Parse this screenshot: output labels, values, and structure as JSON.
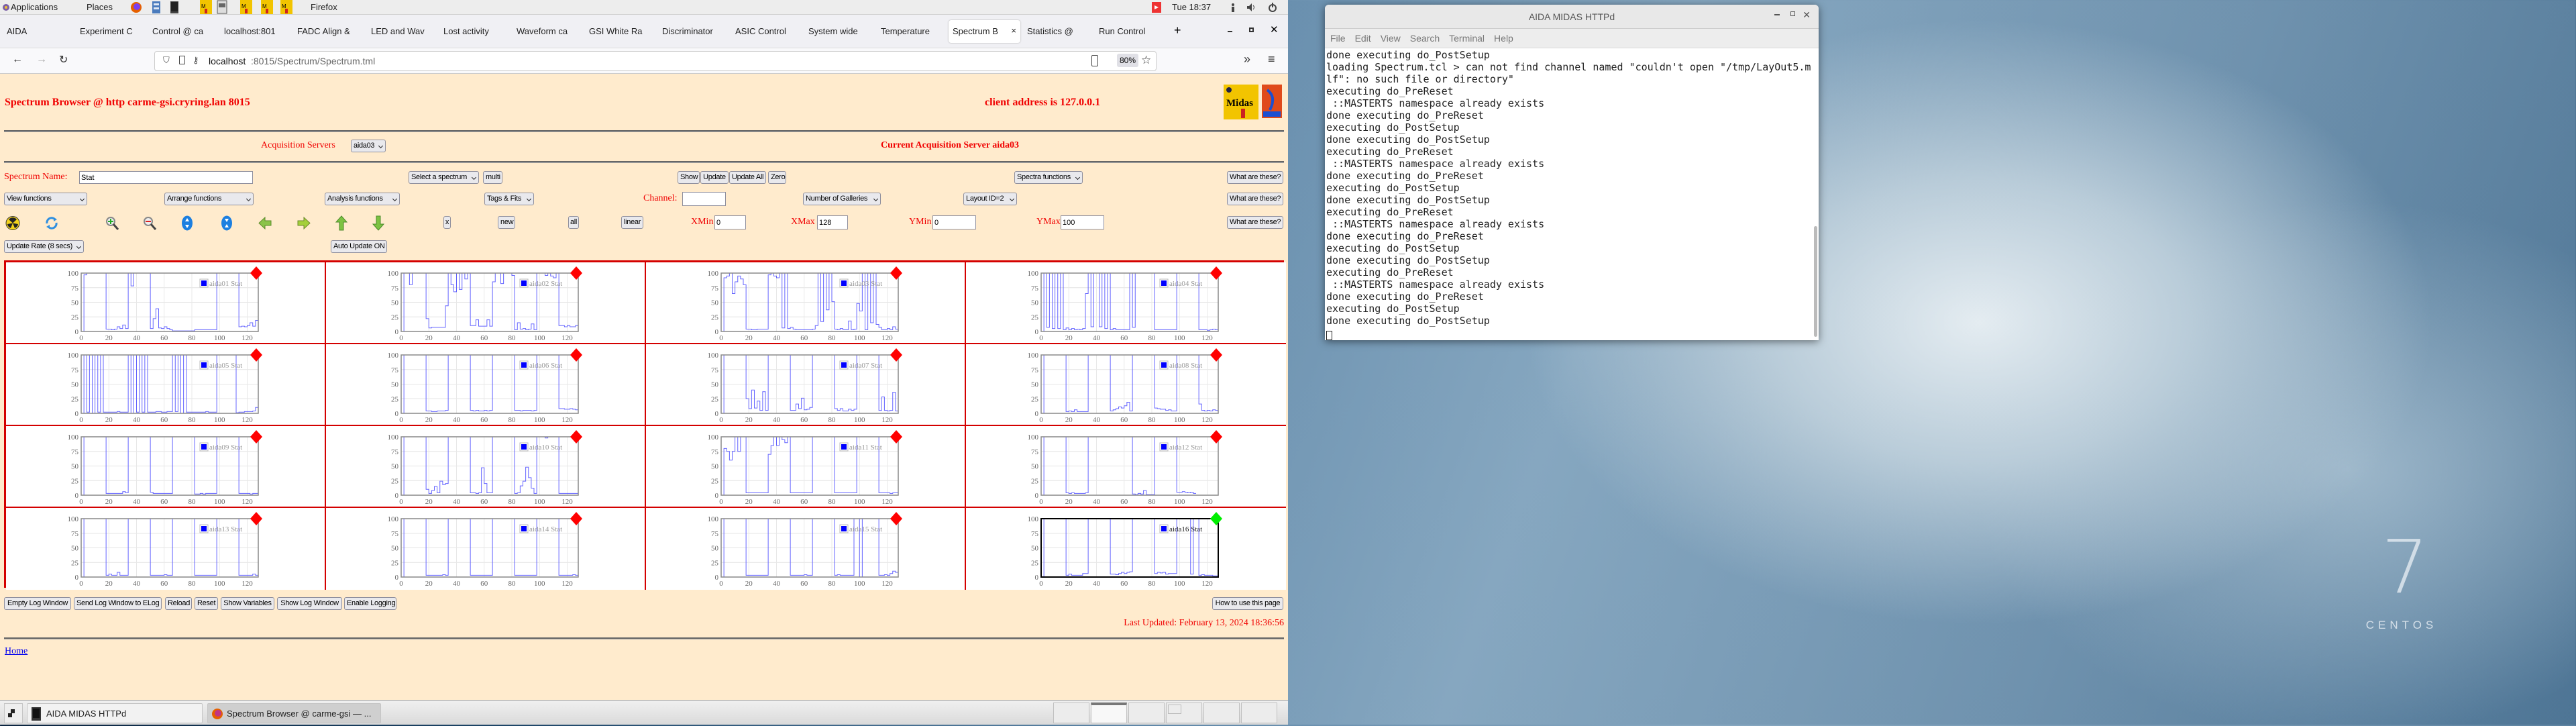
{
  "top_panel": {
    "applications": "Applications",
    "places": "Places",
    "app_name": "Firefox",
    "clock": "Tue 18:37"
  },
  "browser": {
    "tabs": [
      "AIDA",
      "Experiment C",
      "Control @ ca",
      "localhost:801",
      "FADC Align &",
      "LED and Wav",
      "Lost activity",
      "Waveform ca",
      "GSI White Ra",
      "Discriminator",
      "ASIC Control",
      "System wide",
      "Temperature",
      "Spectrum B",
      "Statistics @",
      "Run Control"
    ],
    "active_tab": 13,
    "new_tab": "+",
    "url_host": "localhost",
    "url_path": ":8015/Spectrum/Spectrum.tml",
    "zoom": "80%"
  },
  "page": {
    "title": "Spectrum Browser @ http carme-gsi.cryring.lan 8015",
    "client_address": "client address is 127.0.0.1",
    "acq_label": "Acquisition Servers",
    "acq_select": "aida03",
    "current_server": "Current Acquisition Server aida03",
    "spectrum_name_label": "Spectrum Name:",
    "spectrum_name_value": "Stat",
    "select_spectrum": "Select a spectrum",
    "multi": "multi",
    "show": "Show",
    "update": "Update",
    "update_all": "Update All",
    "zero": "Zero",
    "spectra_functions": "Spectra functions",
    "what_are_these": "What are these?",
    "view_functions": "View functions",
    "arrange_functions": "Arrange functions",
    "analysis_functions": "Analysis functions",
    "tags_fits": "Tags & Fits",
    "channel_label": "Channel:",
    "channel_value": "",
    "num_galleries": "Number of Galleries",
    "layout_id": "Layout ID=2",
    "x_btn": "x",
    "new_btn": "new",
    "all_btn": "all",
    "linear_btn": "linear",
    "xmin_label": "XMin",
    "xmin_value": "0",
    "xmax_label": "XMax",
    "xmax_value": "128",
    "ymin_label": "YMin",
    "ymin_value": "0",
    "ymax_label": "YMax",
    "ymax_value": "100",
    "update_rate": "Update Rate (8 secs)",
    "auto_update": "Auto Update ON",
    "bottom_buttons": [
      "Empty Log Window",
      "Send Log Window to ELog",
      "Reload",
      "Reset",
      "Show Variables",
      "Show Log Window",
      "Enable Logging"
    ],
    "how_to_use": "How to use this page",
    "last_updated": "Last Updated: February 13, 2024 18:36:56",
    "home_link": "Home"
  },
  "terminal": {
    "title": "AIDA MIDAS HTTPd",
    "menu": [
      "File",
      "Edit",
      "View",
      "Search",
      "Terminal",
      "Help"
    ],
    "lines": [
      "done executing do_PostSetup",
      "loading Spectrum.tcl > can not find channel named \"couldn't open \"/tmp/LayOut5.m",
      "lf\": no such file or directory\"",
      "executing do_PreReset",
      " ::MASTERTS namespace already exists",
      "done executing do_PreReset",
      "executing do_PostSetup",
      "done executing do_PostSetup",
      "executing do_PreReset",
      " ::MASTERTS namespace already exists",
      "done executing do_PreReset",
      "executing do_PostSetup",
      "done executing do_PostSetup",
      "executing do_PreReset",
      " ::MASTERTS namespace already exists",
      "done executing do_PreReset",
      "executing do_PostSetup",
      "done executing do_PostSetup",
      "executing do_PreReset",
      " ::MASTERTS namespace already exists",
      "done executing do_PreReset",
      "executing do_PostSetup",
      "done executing do_PostSetup"
    ]
  },
  "desktop": {
    "logo_number": "7",
    "logo_text": "CENTOS"
  },
  "taskbar": {
    "items": [
      "AIDA MIDAS HTTPd",
      "Spectrum Browser @ carme-gsi — ..."
    ]
  },
  "colors": {
    "page_bg": "#ffebcd",
    "accent_red": "#f00000",
    "line": "#4a4aff",
    "status_bad": "#ff0000",
    "status_ok": "#00ee00",
    "grid_border": "#d40000"
  },
  "chart_data": {
    "type": "line",
    "x_step": 2,
    "xlim": [
      0,
      128
    ],
    "ylim": [
      0,
      100
    ],
    "xticks": [
      "0",
      "20",
      "40",
      "60",
      "80",
      "100",
      "120"
    ],
    "yticks": [
      "0",
      "25",
      "50",
      "75",
      "100"
    ],
    "grid": true,
    "legend": "top-right",
    "selected": 15,
    "series": [
      {
        "name": "aida01 Stat",
        "status": "bad",
        "values": [
          0,
          97,
          100,
          100,
          100,
          100,
          100,
          100,
          100,
          4,
          4,
          3,
          4,
          8,
          5,
          11,
          5,
          100,
          78,
          100,
          100,
          100,
          100,
          100,
          100,
          5,
          22,
          39,
          6,
          5,
          8,
          5,
          3,
          1,
          1,
          1,
          1,
          1,
          1,
          1,
          1,
          3,
          3,
          3,
          3,
          3,
          3,
          3,
          3,
          100,
          100,
          100,
          100,
          100,
          100,
          100,
          100,
          8,
          9,
          8,
          10,
          15,
          9,
          19
        ]
      },
      {
        "name": "aida02 Stat",
        "status": "bad",
        "values": [
          0,
          100,
          100,
          80,
          100,
          100,
          100,
          100,
          100,
          22,
          6,
          7,
          7,
          7,
          7,
          7,
          44,
          100,
          80,
          68,
          100,
          72,
          100,
          90,
          100,
          10,
          10,
          20,
          9,
          9,
          9,
          20,
          9,
          85,
          100,
          100,
          82,
          100,
          100,
          100,
          96,
          3,
          15,
          4,
          5,
          3,
          4,
          13,
          3,
          100,
          100,
          100,
          96,
          100,
          95,
          92,
          100,
          10,
          10,
          8,
          10,
          8,
          8,
          10
        ]
      },
      {
        "name": "aida03 Stat",
        "status": "bad",
        "values": [
          0,
          92,
          95,
          100,
          65,
          85,
          95,
          90,
          80,
          4,
          4,
          3,
          3,
          4,
          4,
          4,
          4,
          97,
          100,
          95,
          92,
          100,
          6,
          100,
          5,
          7,
          4,
          3,
          3,
          3,
          3,
          3,
          3,
          4,
          10,
          100,
          17,
          100,
          37,
          100,
          51,
          4,
          3,
          5,
          3,
          3,
          18,
          3,
          4,
          48,
          35,
          100,
          3,
          100,
          15,
          100,
          12,
          7,
          3,
          3,
          5,
          3,
          8,
          4
        ]
      },
      {
        "name": "aida04 Stat",
        "status": "bad",
        "values": [
          0,
          100,
          7,
          100,
          5,
          100,
          5,
          100,
          3,
          6,
          3,
          5,
          3,
          4,
          3,
          5,
          65,
          100,
          8,
          100,
          100,
          8,
          100,
          5,
          100,
          3,
          5,
          3,
          3,
          3,
          3,
          3,
          100,
          7,
          100,
          100,
          100,
          100,
          100,
          100,
          100,
          3,
          3,
          3,
          3,
          3,
          3,
          3,
          3,
          100,
          100,
          100,
          100,
          100,
          100,
          100,
          100,
          3,
          3,
          3,
          2,
          3,
          4,
          3
        ]
      },
      {
        "name": "aida05 Stat",
        "status": "bad",
        "values": [
          0,
          100,
          2,
          100,
          0,
          100,
          2,
          100,
          2,
          2,
          2,
          2,
          2,
          3,
          2,
          2,
          2,
          100,
          0,
          100,
          2,
          100,
          2,
          100,
          2,
          2,
          2,
          3,
          3,
          2,
          2,
          3,
          3,
          100,
          3,
          100,
          0,
          100,
          2,
          2,
          2,
          2,
          2,
          2,
          2,
          3,
          2,
          2,
          2,
          100,
          100,
          100,
          100,
          100,
          100,
          100,
          1,
          2,
          2,
          3,
          3,
          3,
          4,
          10
        ]
      },
      {
        "name": "aida06 Stat",
        "status": "bad",
        "values": [
          0,
          100,
          100,
          100,
          100,
          100,
          100,
          100,
          100,
          4,
          4,
          3,
          3,
          4,
          4,
          4,
          5,
          100,
          100,
          100,
          100,
          100,
          100,
          100,
          100,
          5,
          4,
          5,
          4,
          4,
          5,
          4,
          5,
          100,
          100,
          100,
          100,
          100,
          100,
          100,
          100,
          5,
          5,
          4,
          5,
          5,
          5,
          4,
          5,
          100,
          100,
          100,
          100,
          100,
          100,
          100,
          100,
          8,
          8,
          7,
          7,
          8,
          7,
          6
        ]
      },
      {
        "name": "aida07 Stat",
        "status": "bad",
        "values": [
          0,
          100,
          100,
          100,
          100,
          100,
          100,
          100,
          100,
          25,
          8,
          40,
          9,
          21,
          5,
          37,
          5,
          100,
          100,
          100,
          100,
          100,
          100,
          100,
          100,
          5,
          5,
          16,
          8,
          26,
          6,
          7,
          10,
          100,
          100,
          100,
          100,
          100,
          100,
          100,
          100,
          8,
          5,
          8,
          4,
          4,
          7,
          5,
          7,
          100,
          100,
          100,
          100,
          100,
          100,
          100,
          100,
          5,
          28,
          5,
          4,
          5,
          36,
          4
        ]
      },
      {
        "name": "aida08 Stat",
        "status": "bad",
        "values": [
          0,
          100,
          100,
          100,
          100,
          100,
          100,
          100,
          100,
          3,
          4,
          3,
          6,
          3,
          3,
          3,
          3,
          100,
          100,
          100,
          100,
          100,
          100,
          100,
          100,
          4,
          6,
          8,
          11,
          9,
          13,
          19,
          4,
          100,
          100,
          100,
          100,
          100,
          100,
          100,
          100,
          9,
          8,
          7,
          7,
          5,
          6,
          4,
          4,
          100,
          100,
          100,
          100,
          100,
          100,
          100,
          100,
          16,
          5,
          4,
          5,
          4,
          6,
          5
        ]
      },
      {
        "name": "aida09 Stat",
        "status": "bad",
        "values": [
          0,
          100,
          100,
          100,
          100,
          100,
          100,
          100,
          100,
          3,
          3,
          3,
          3,
          3,
          3,
          6,
          4,
          100,
          100,
          100,
          100,
          100,
          100,
          100,
          100,
          5,
          3,
          3,
          3,
          3,
          3,
          3,
          3,
          100,
          100,
          100,
          100,
          100,
          100,
          100,
          100,
          2,
          2,
          3,
          2,
          3,
          3,
          3,
          3,
          100,
          100,
          100,
          100,
          100,
          100,
          100,
          100,
          3,
          3,
          3,
          3,
          2,
          3,
          3
        ]
      },
      {
        "name": "aida10 Stat",
        "status": "bad",
        "values": [
          0,
          100,
          100,
          100,
          100,
          100,
          100,
          100,
          100,
          10,
          3,
          8,
          15,
          4,
          24,
          18,
          20,
          100,
          100,
          100,
          100,
          100,
          100,
          100,
          100,
          4,
          4,
          3,
          4,
          47,
          20,
          4,
          4,
          100,
          100,
          100,
          100,
          100,
          100,
          100,
          100,
          3,
          4,
          16,
          24,
          48,
          30,
          12,
          3,
          100,
          100,
          100,
          98,
          100,
          100,
          100,
          100,
          3,
          3,
          3,
          3,
          3,
          3,
          3
        ]
      },
      {
        "name": "aida11 Stat",
        "status": "bad",
        "values": [
          0,
          80,
          75,
          60,
          75,
          100,
          75,
          100,
          100,
          4,
          4,
          4,
          4,
          4,
          4,
          4,
          4,
          70,
          85,
          100,
          85,
          100,
          95,
          90,
          100,
          4,
          4,
          4,
          4,
          4,
          4,
          4,
          4,
          100,
          100,
          100,
          100,
          100,
          100,
          100,
          100,
          4,
          4,
          4,
          4,
          4,
          4,
          4,
          4,
          100,
          100,
          100,
          100,
          100,
          100,
          100,
          100,
          4,
          4,
          4,
          4,
          3,
          4,
          4
        ]
      },
      {
        "name": "aida12 Stat",
        "status": "bad",
        "values": [
          0,
          100,
          100,
          100,
          100,
          100,
          100,
          100,
          100,
          4,
          3,
          4,
          3,
          3,
          3,
          3,
          4,
          100,
          100,
          100,
          100,
          100,
          100,
          100,
          100,
          100,
          100,
          100,
          100,
          100,
          100,
          100,
          100,
          2,
          1,
          3,
          2,
          8,
          1,
          1,
          1,
          100,
          100,
          100,
          100,
          100,
          100,
          100,
          100,
          5,
          5,
          6,
          5,
          4,
          5,
          3
        ]
      },
      {
        "name": "aida13 Stat",
        "status": "bad",
        "values": [
          0,
          100,
          100,
          100,
          100,
          100,
          100,
          100,
          100,
          3,
          5,
          3,
          3,
          8,
          3,
          3,
          3,
          100,
          100,
          100,
          100,
          100,
          100,
          100,
          100,
          3,
          3,
          3,
          3,
          3,
          4,
          3,
          3,
          100,
          100,
          100,
          100,
          100,
          100,
          100,
          100,
          3,
          3,
          3,
          3,
          3,
          3,
          3,
          3,
          100,
          100,
          100,
          100,
          100,
          100,
          100,
          100,
          3,
          3,
          3,
          3,
          3,
          5,
          3
        ]
      },
      {
        "name": "aida14 Stat",
        "status": "bad",
        "values": [
          0,
          100,
          100,
          100,
          100,
          100,
          100,
          100,
          100,
          3,
          3,
          3,
          3,
          3,
          3,
          4,
          3,
          100,
          100,
          100,
          100,
          100,
          100,
          100,
          100,
          3,
          3,
          3,
          3,
          3,
          3,
          3,
          3,
          100,
          100,
          100,
          100,
          100,
          100,
          100,
          100,
          3,
          3,
          3,
          3,
          3,
          3,
          3,
          3,
          100,
          100,
          100,
          100,
          100,
          100,
          100,
          100,
          3,
          3,
          3,
          3,
          3,
          4,
          3
        ]
      },
      {
        "name": "aida15 Stat",
        "status": "bad",
        "values": [
          0,
          100,
          100,
          100,
          100,
          100,
          100,
          100,
          100,
          3,
          3,
          3,
          3,
          3,
          3,
          3,
          3,
          100,
          100,
          100,
          100,
          100,
          100,
          100,
          100,
          3,
          3,
          3,
          3,
          3,
          4,
          3,
          3,
          100,
          100,
          100,
          100,
          100,
          100,
          100,
          100,
          3,
          4,
          3,
          3,
          3,
          3,
          3,
          100,
          100,
          0,
          100,
          100,
          100,
          100,
          100,
          100,
          3,
          3,
          4,
          3,
          6,
          10,
          8
        ]
      },
      {
        "name": "aida16 Stat",
        "status": "ok",
        "values": [
          0,
          100,
          100,
          100,
          100,
          100,
          100,
          100,
          100,
          3,
          5,
          3,
          3,
          3,
          3,
          6,
          6,
          100,
          100,
          100,
          100,
          100,
          100,
          100,
          100,
          5,
          5,
          4,
          6,
          8,
          6,
          8,
          9,
          100,
          100,
          100,
          100,
          100,
          100,
          100,
          100,
          6,
          8,
          7,
          8,
          5,
          6,
          6,
          6,
          100,
          100,
          100,
          100,
          100,
          5,
          100,
          100,
          3,
          4,
          3,
          3,
          3,
          2,
          2
        ]
      }
    ]
  }
}
